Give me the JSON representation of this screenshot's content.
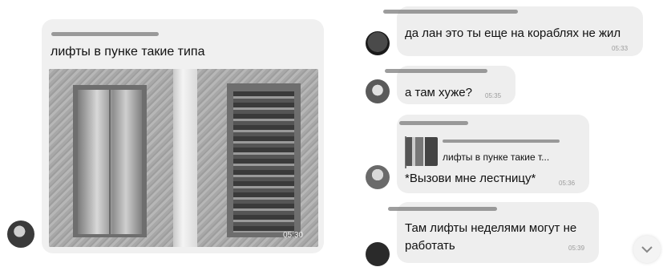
{
  "left_message": {
    "text": "лифты в пунке такие типа",
    "photo_time": "05:30"
  },
  "chat": [
    {
      "text": "да лан это ты еще на кораблях не жил",
      "time": "05:33"
    },
    {
      "text": "а там хуже?",
      "time": "05:35"
    },
    {
      "reply_preview": "лифты в пунке такие т...",
      "text": "*Вызови мне лестницу*",
      "time": "05:36"
    },
    {
      "text_line1": "Там лифты неделями могут не",
      "text_line2": "работать",
      "time": "05:39"
    }
  ],
  "icons": {
    "scroll_down": "chevron-down-icon",
    "avatar": "avatar"
  }
}
